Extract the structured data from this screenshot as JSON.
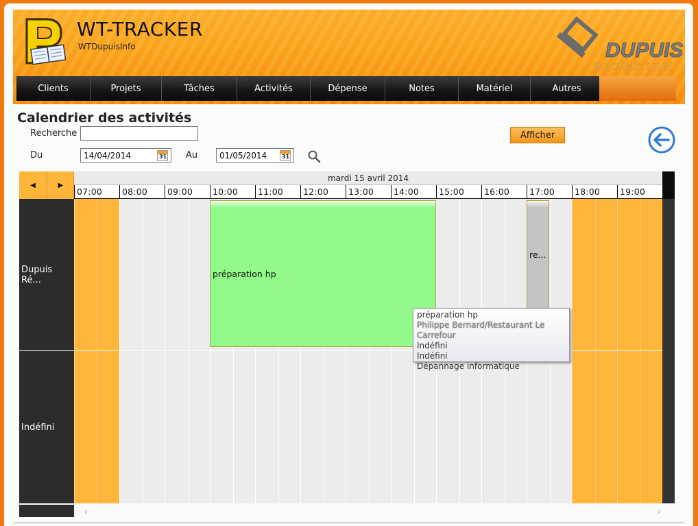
{
  "app": {
    "title": "WT-TRACKER",
    "subtitle": "WTDupuisInfo",
    "brand_name": "DUPUIS",
    "brand_tagline": "INFORMATIQUE"
  },
  "nav": [
    {
      "label": "Clients"
    },
    {
      "label": "Projets"
    },
    {
      "label": "Tâches"
    },
    {
      "label": "Activités"
    },
    {
      "label": "Dépense"
    },
    {
      "label": "Notes"
    },
    {
      "label": "Matériel"
    },
    {
      "label": "Autres"
    }
  ],
  "page": {
    "title": "Calendrier des activités"
  },
  "filters": {
    "search_label": "Recherche",
    "search_value": "",
    "from_label": "Du",
    "from_value": "14/04/2014",
    "to_label": "Au",
    "to_value": "01/05/2014",
    "submit_label": "Afficher",
    "calendar_icon_text": "31"
  },
  "scheduler": {
    "date_header": "mardi 15 avril 2014",
    "prev_symbol": "◀",
    "next_symbol": "▶",
    "hours": [
      "07:00",
      "08:00",
      "09:00",
      "10:00",
      "11:00",
      "12:00",
      "13:00",
      "14:00",
      "15:00",
      "16:00",
      "17:00",
      "18:00",
      "19:00"
    ],
    "resources": [
      {
        "label": "Dupuis Ré..."
      },
      {
        "label": "Indéfini"
      }
    ],
    "events": [
      {
        "label": "préparation hp",
        "color": "#92f98b"
      },
      {
        "label": "re...",
        "color": "#c4c4c4"
      }
    ],
    "tooltip": {
      "lines": [
        "préparation hp",
        "Philippe Bernard/Restaurant Le Carrefour",
        "Indéfini",
        "Indéfini",
        "Dépannage informatique"
      ]
    },
    "scroll_left": "‹",
    "scroll_right": "›"
  },
  "colors": {
    "accent": "#f7961c",
    "offhours": "#fdb53a",
    "resource_bg": "#2c2c2c",
    "event_green": "#92f98b"
  }
}
